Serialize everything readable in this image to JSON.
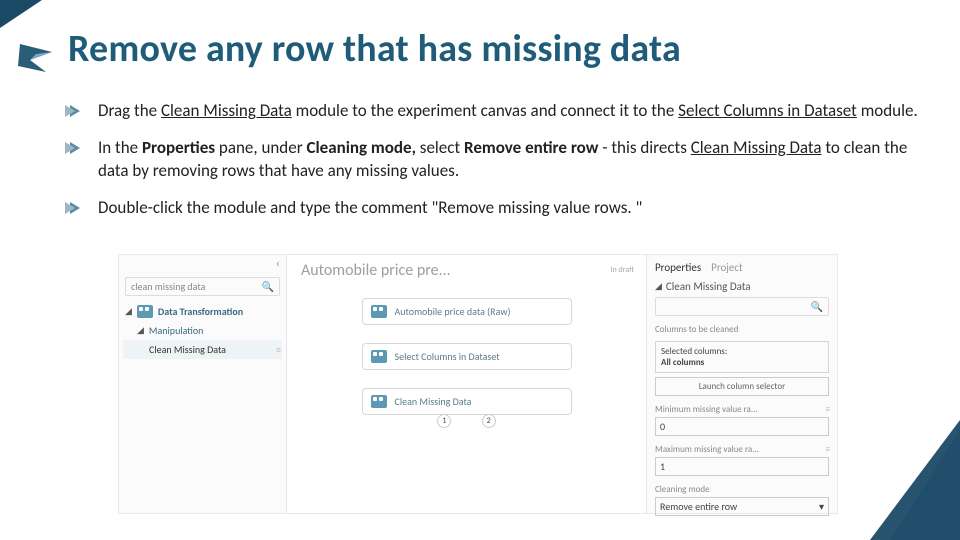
{
  "title": "Remove any row that has missing data",
  "bullets": {
    "b1_pre": "Drag the ",
    "b1_link1": "Clean Missing Data",
    "b1_mid": " module to the experiment canvas and connect it to the ",
    "b1_link2": "Select Columns in Dataset",
    "b1_post": " module.",
    "b2_pre": "In the ",
    "b2_bold1": "Properties",
    "b2_mid1": " pane, under ",
    "b2_bold2": "Cleaning mode,",
    "b2_mid2": " select ",
    "b2_bold3": "Remove entire row",
    "b2_mid3": " - this directs ",
    "b2_link": "Clean Missing Data",
    "b2_post": " to clean the data by removing rows that have any missing values.",
    "b3": "Double-click the module and type the comment \"Remove missing value rows. \""
  },
  "screenshot": {
    "left": {
      "search_placeholder": "clean missing data",
      "cat1": "Data Transformation",
      "cat2": "Manipulation",
      "item": "Clean Missing Data"
    },
    "canvas": {
      "title": "Automobile price pre...",
      "status": "In draft",
      "mod1": "Automobile price data (Raw)",
      "mod2": "Select Columns in Dataset",
      "mod3": "Clean Missing Data",
      "port1": "1",
      "port2": "2"
    },
    "props": {
      "tab1": "Properties",
      "tab2": "Project",
      "section": "Clean Missing Data",
      "cols_label": "Columns to be cleaned",
      "sel_label": "Selected columns:",
      "sel_val": "All columns",
      "launch": "Launch column selector",
      "min_label": "Minimum missing value ra...",
      "min_val": "0",
      "max_label": "Maximum missing value ra...",
      "max_val": "1",
      "mode_label": "Cleaning mode",
      "mode_val": "Remove entire row"
    }
  }
}
